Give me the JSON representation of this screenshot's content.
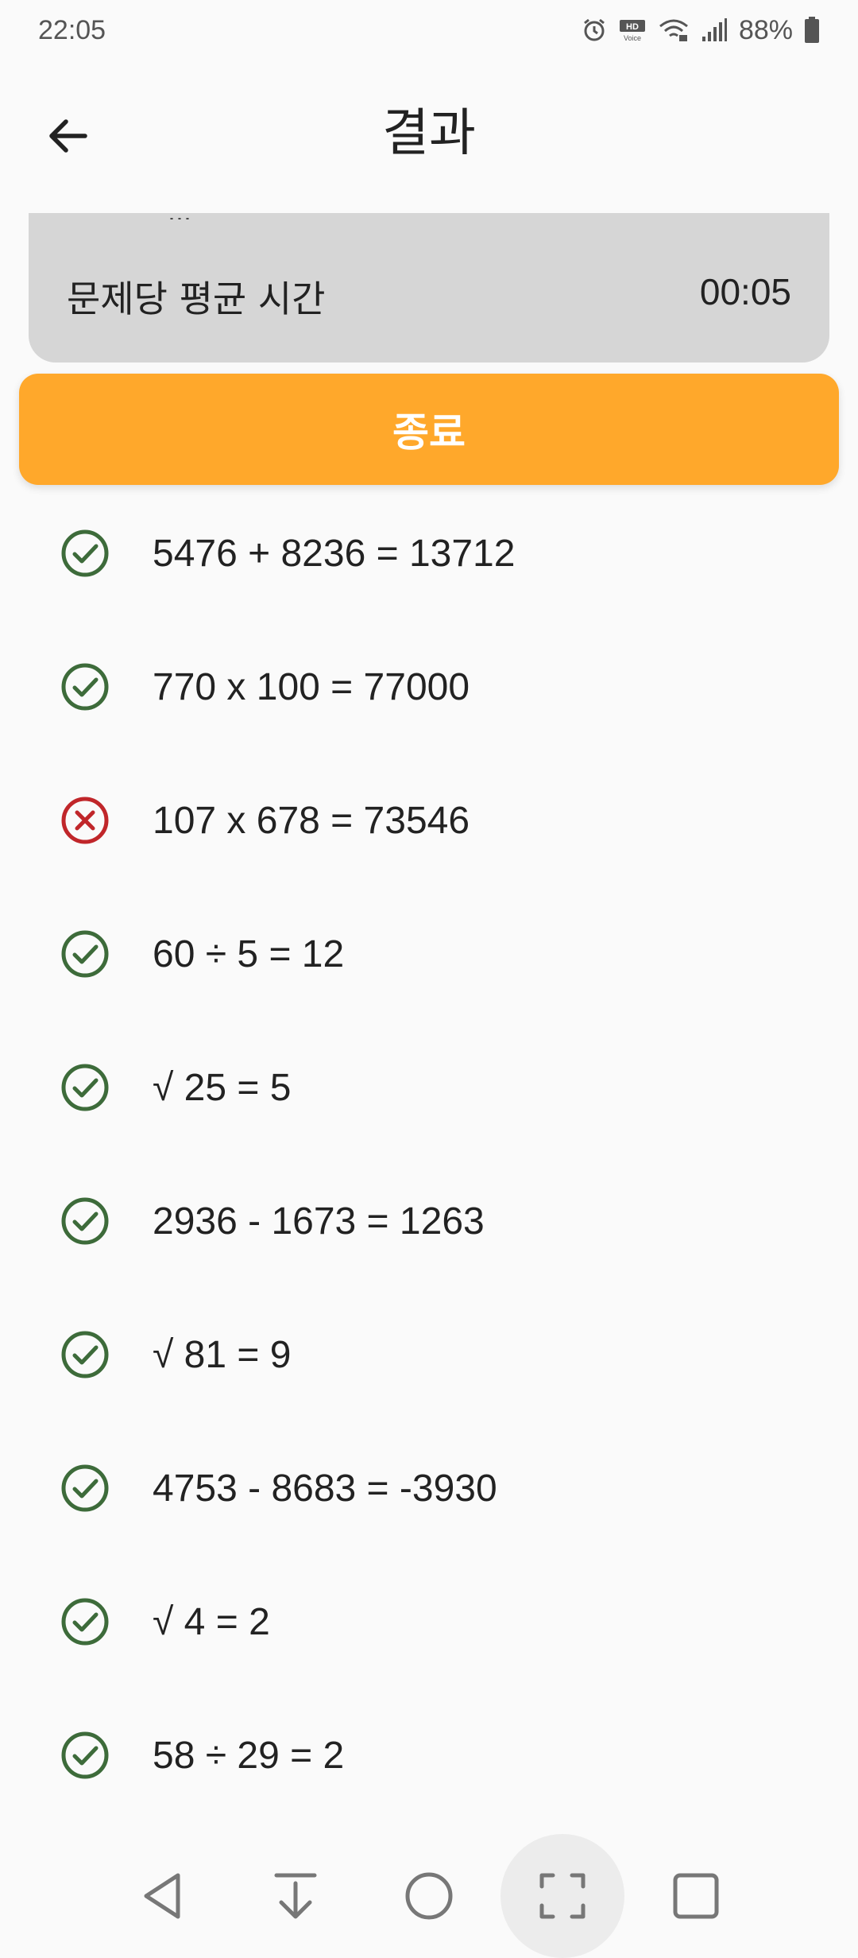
{
  "status_bar": {
    "time": "22:05",
    "battery": "88%",
    "icons": [
      "alarm-icon",
      "hd-voice-icon",
      "wifi-icon",
      "signal-icon",
      "battery-icon"
    ]
  },
  "app_bar": {
    "title": "결과",
    "back_icon": "arrow-left-icon"
  },
  "summary": {
    "peek_text": "…",
    "avg_label": "문제당 평균 시간",
    "avg_value": "00:05"
  },
  "exit_button": {
    "label": "종료",
    "color": "#ffa82b"
  },
  "results": [
    {
      "text": "5476 + 8236 = 13712",
      "status": "correct"
    },
    {
      "text": "770 x 100 = 77000",
      "status": "correct"
    },
    {
      "text": "107 x 678 = 73546",
      "status": "wrong"
    },
    {
      "text": "60 ÷ 5 = 12",
      "status": "correct"
    },
    {
      "text": "√ 25 = 5",
      "status": "correct"
    },
    {
      "text": "2936 - 1673 = 1263",
      "status": "correct"
    },
    {
      "text": "√ 81 = 9",
      "status": "correct"
    },
    {
      "text": "4753 - 8683 = -3930",
      "status": "correct"
    },
    {
      "text": "√ 4 = 2",
      "status": "correct"
    },
    {
      "text": "58 ÷ 29 = 2",
      "status": "correct"
    }
  ],
  "colors": {
    "correct": "#3d6b3a",
    "wrong": "#c0262a"
  },
  "nav_bar": {
    "items": [
      "back-triangle-icon",
      "download-arrow-icon",
      "home-circle-icon",
      "screenshot-frame-icon",
      "recents-square-icon"
    ]
  }
}
